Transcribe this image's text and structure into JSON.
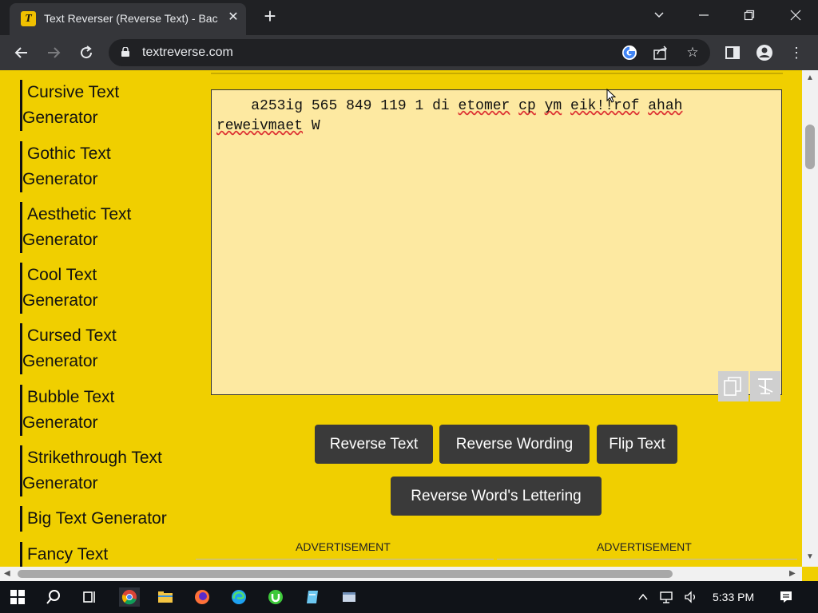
{
  "browser": {
    "tab_title": "Text Reverser (Reverse Text) - Bac",
    "tab_favicon_letter": "T",
    "url": "textreverse.com"
  },
  "sidebar": {
    "items": [
      {
        "line1": "Cursive Text",
        "line2": "Generator"
      },
      {
        "line1": "Gothic Text",
        "line2": "Generator"
      },
      {
        "line1": "Aesthetic Text",
        "line2": "Generator"
      },
      {
        "line1": "Cool Text",
        "line2": "Generator"
      },
      {
        "line1": "Cursed Text",
        "line2": "Generator"
      },
      {
        "line1": "Bubble Text",
        "line2": "Generator"
      },
      {
        "line1": "Strikethrough Text",
        "line2": "Generator"
      },
      {
        "line1": "Big Text Generator",
        "line2": ""
      },
      {
        "line1": "Fancy Text",
        "line2": ""
      }
    ]
  },
  "editor": {
    "words": [
      "a253ig",
      "565",
      "849",
      "119",
      "1",
      "di",
      "etomer",
      "cp",
      "ym",
      "eik!!rof",
      "ahah",
      "reweivmaet",
      "W"
    ]
  },
  "buttons": {
    "reverse_text": "Reverse Text",
    "reverse_wording": "Reverse Wording",
    "flip_text": "Flip Text",
    "reverse_word_lettering": "Reverse Word's Lettering"
  },
  "ads": {
    "left": "ADVERTISEMENT",
    "right": "ADVERTISEMENT"
  },
  "taskbar": {
    "time": "5:33 PM"
  },
  "colors": {
    "page_bg": "#f0cf00",
    "textarea_bg": "#fde9a1",
    "button_bg": "#3a3a3a"
  }
}
